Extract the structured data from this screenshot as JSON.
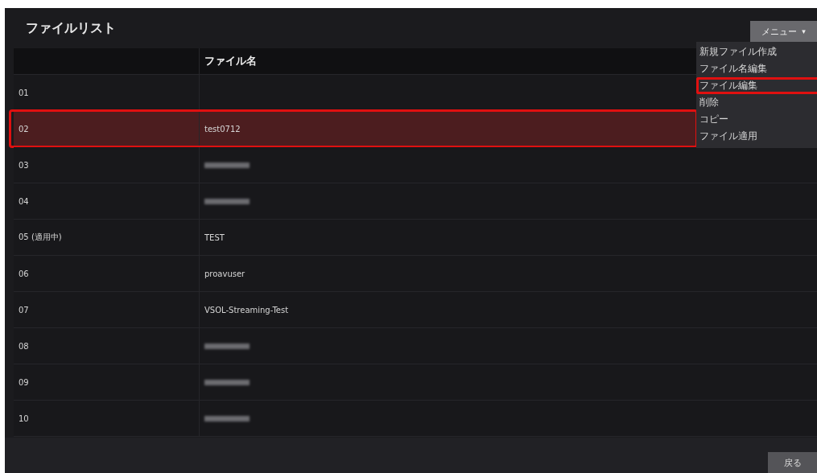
{
  "title": "ファイルリスト",
  "menu_button": {
    "label": "メニュー",
    "caret": "▾",
    "expanded": true
  },
  "menu_items": [
    {
      "label": "新規ファイル作成",
      "annotated": false
    },
    {
      "label": "ファイル名編集",
      "annotated": false
    },
    {
      "label": "ファイル編集",
      "annotated": true
    },
    {
      "label": "削除",
      "annotated": false
    },
    {
      "label": "コピー",
      "annotated": false
    },
    {
      "label": "ファイル適用",
      "annotated": false
    }
  ],
  "table": {
    "columns": [
      "ファイル名"
    ],
    "rows": [
      {
        "number": "01",
        "selected": false,
        "annotated": false
      },
      {
        "number": "02",
        "name": "test0712",
        "selected": true,
        "annotated": true
      },
      {
        "number": "03",
        "redacted": true,
        "selected": false,
        "annotated": false
      },
      {
        "number": "04",
        "redacted": true,
        "selected": false,
        "annotated": false
      },
      {
        "number": "05 (適用中)",
        "name": "TEST",
        "selected": false,
        "annotated": false
      },
      {
        "number": "06",
        "name": "proavuser",
        "selected": false,
        "annotated": false
      },
      {
        "number": "07",
        "name": "VSOL-Streaming-Test",
        "selected": false,
        "annotated": false
      },
      {
        "number": "08",
        "redacted": true,
        "selected": false,
        "annotated": false
      },
      {
        "number": "09",
        "redacted": true,
        "selected": false,
        "annotated": false
      },
      {
        "number": "10",
        "redacted": true,
        "selected": false,
        "annotated": false
      }
    ]
  },
  "back_button": "戻る"
}
